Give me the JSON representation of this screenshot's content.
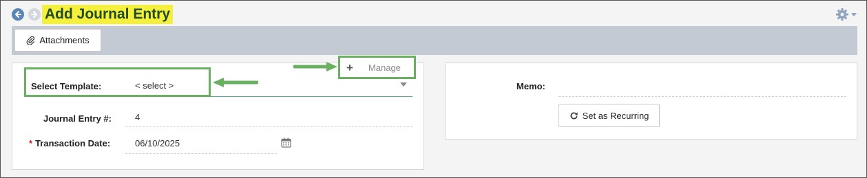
{
  "header": {
    "title": "Add Journal Entry",
    "back_icon": "arrow-left-icon",
    "forward_icon": "arrow-right-icon",
    "settings_icon": "gear-icon"
  },
  "toolbar": {
    "attachments_label": "Attachments",
    "attachments_icon": "paperclip-icon"
  },
  "form": {
    "template": {
      "label": "Select Template:",
      "value": "< select >"
    },
    "manage": {
      "label": "Manage",
      "icon": "plus-icon"
    },
    "journal_entry": {
      "label": "Journal Entry #:",
      "value": "4"
    },
    "transaction_date": {
      "required_mark": "*",
      "label": "Transaction Date:",
      "value": "06/10/2025",
      "icon": "calendar-icon"
    },
    "memo": {
      "label": "Memo:",
      "value": ""
    },
    "recurring": {
      "label": "Set as Recurring",
      "icon": "refresh-icon"
    }
  },
  "colors": {
    "highlight": "#f5f03c",
    "callout": "#6ab061",
    "toolbar_bg": "#c3cad4",
    "required": "#d02020"
  }
}
